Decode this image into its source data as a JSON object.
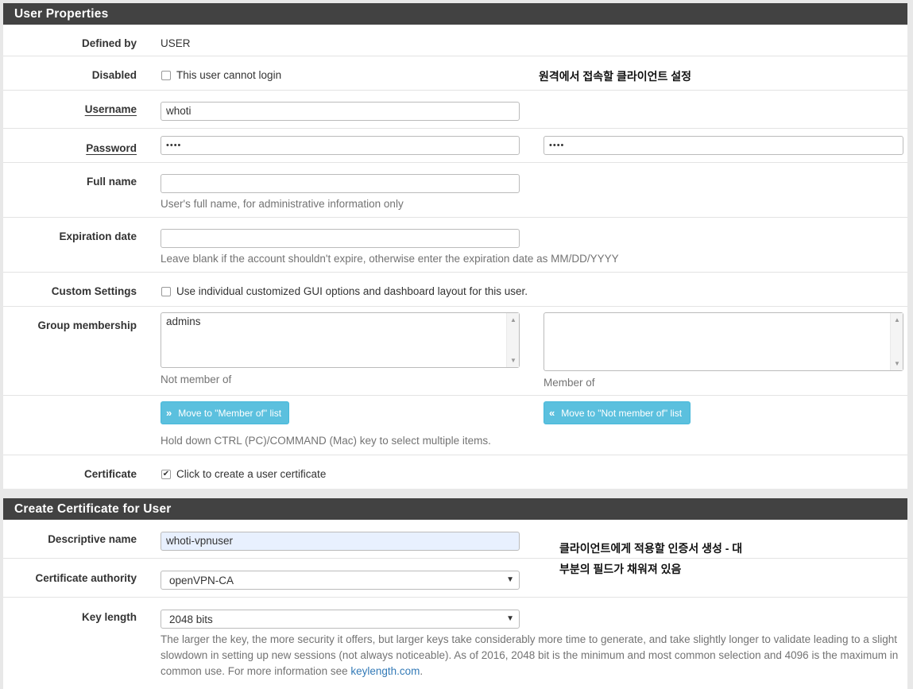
{
  "user_properties": {
    "title": "User Properties",
    "defined_by": {
      "label": "Defined by",
      "value": "USER"
    },
    "disabled": {
      "label": "Disabled",
      "checkbox_label": "This user cannot login",
      "checked": false
    },
    "username": {
      "label": "Username",
      "value": "whoti"
    },
    "password": {
      "label": "Password",
      "value": "••••",
      "confirm_value": "••••"
    },
    "full_name": {
      "label": "Full name",
      "value": "",
      "help": "User's full name, for administrative information only"
    },
    "expiration": {
      "label": "Expiration date",
      "value": "",
      "help": "Leave blank if the account shouldn't expire, otherwise enter the expiration date as MM/DD/YYYY"
    },
    "custom_settings": {
      "label": "Custom Settings",
      "checkbox_label": "Use individual customized GUI options and dashboard layout for this user.",
      "checked": false
    },
    "group_membership": {
      "label": "Group membership",
      "not_member_items": [
        "admins"
      ],
      "not_member_label": "Not member of",
      "member_items": [],
      "member_label": "Member of",
      "move_to_member_button": "Move to \"Member of\" list",
      "move_to_not_member_button": "Move to \"Not member of\" list",
      "help": "Hold down CTRL (PC)/COMMAND (Mac) key to select multiple items."
    },
    "certificate": {
      "label": "Certificate",
      "checkbox_label": "Click to create a user certificate",
      "checked": true
    }
  },
  "create_certificate": {
    "title": "Create Certificate for User",
    "descriptive_name": {
      "label": "Descriptive name",
      "value": "whoti-vpnuser"
    },
    "certificate_authority": {
      "label": "Certificate authority",
      "value": "openVPN-CA"
    },
    "key_length": {
      "label": "Key length",
      "value": "2048 bits",
      "help": "The larger the key, the more security it offers, but larger keys take considerably more time to generate, and take slightly longer to validate leading to a slight slowdown in setting up new sessions (not always noticeable). As of 2016, 2048 bit is the minimum and most common selection and 4096 is the maximum in common use. For more information see ",
      "help_link": "keylength.com",
      "help_end": "."
    }
  },
  "annotations": {
    "client_settings": "원격에서 접속할 클라이언트 설정",
    "certificate_note_line1": "클라이언트에게 적용할 인증서 생성 - 대",
    "certificate_note_line2": "부분의 필드가 채워져 있음"
  },
  "colors": {
    "header_bg": "#424242",
    "button_bg": "#5bc0de",
    "link": "#337ab7"
  },
  "icons": {
    "move_right": "double-chevron-right-icon",
    "move_left": "double-chevron-left-icon",
    "select_caret": "caret-down-icon"
  }
}
